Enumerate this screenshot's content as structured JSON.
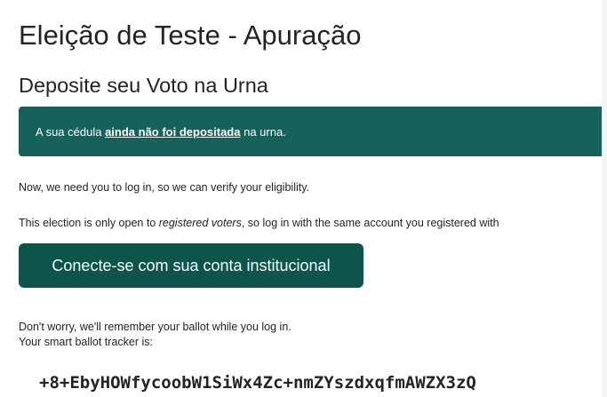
{
  "page": {
    "title": "Eleição de Teste - Apuração",
    "section_title": "Deposite seu Voto na Urna"
  },
  "alert": {
    "prefix": "A sua cédula ",
    "emphasis": "ainda não foi depositada",
    "suffix": " na urna."
  },
  "text": {
    "login_needed": "Now, we need you to log in, so we can verify your eligibility.",
    "open_prefix": "This election is only open to ",
    "open_emphasis": "registered voters",
    "open_suffix": ", so log in with the same account you registered with",
    "remember": "Don't worry, we'll remember your ballot while you log in.",
    "tracker_label": "Your smart ballot tracker is:"
  },
  "login_button": {
    "label": "Conecte-se com sua conta institucional"
  },
  "tracker": {
    "value": "+8+EbyHOWfycoobW1SiWx4Zc+nmZYszdxqfmAWZX3zQ"
  },
  "colors": {
    "alert_bg": "#15625a",
    "button_bg": "#0d544b",
    "text": "#212529"
  }
}
